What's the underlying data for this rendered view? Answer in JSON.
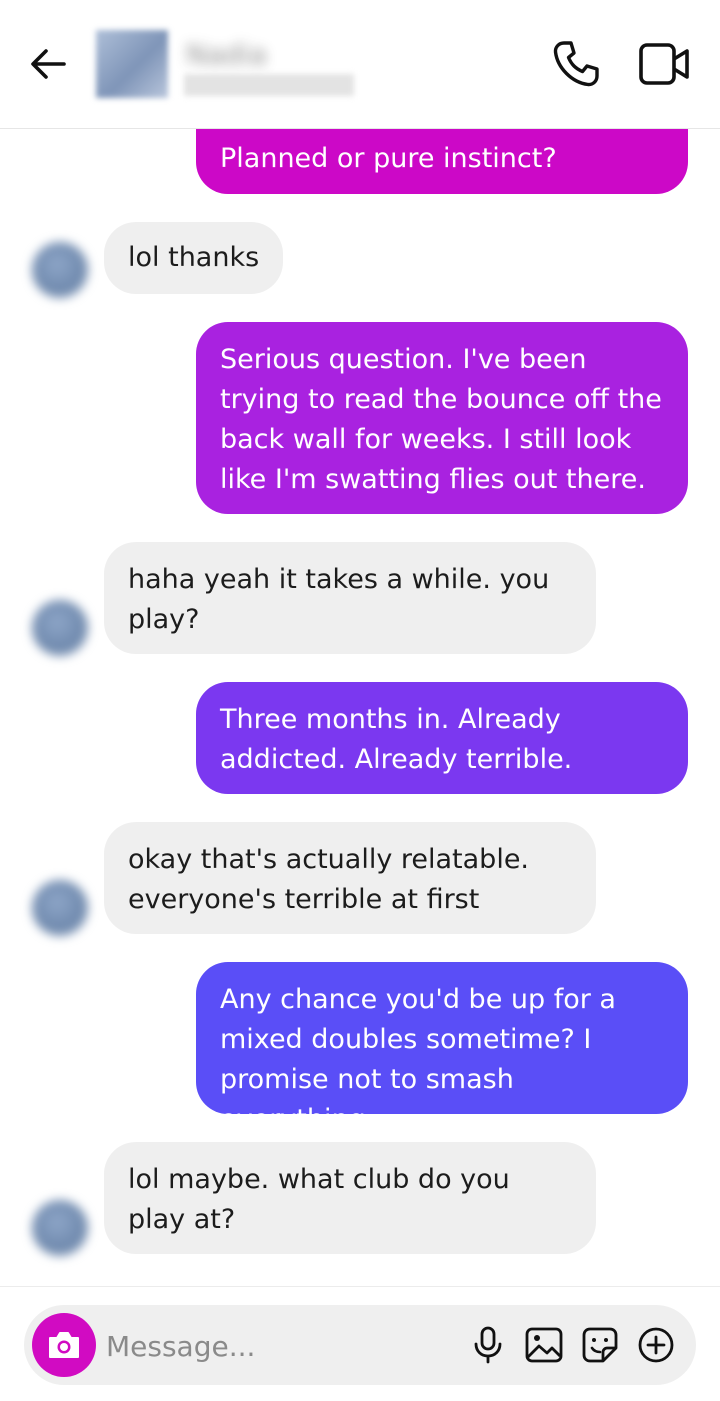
{
  "header": {
    "contact_name": "Nadia",
    "back_icon": "arrow-left-icon",
    "call_icon": "phone-icon",
    "video_icon": "video-camera-icon"
  },
  "messages": [
    {
      "sender": "me",
      "text": "Planned or pure instinct?",
      "color": "#cc08c7"
    },
    {
      "sender": "them",
      "text": "lol thanks"
    },
    {
      "sender": "me",
      "text": "Serious question. I've been trying to read the bounce off the back wall for weeks. I still look like I'm swatting flies out there.",
      "color": "#a922e0"
    },
    {
      "sender": "them",
      "text": "haha yeah it takes a while. you play?"
    },
    {
      "sender": "me",
      "text": "Three months in. Already addicted. Already terrible.",
      "color": "#7b38f0"
    },
    {
      "sender": "them",
      "text": "okay that's actually relatable. everyone's terrible at first"
    },
    {
      "sender": "me",
      "text": "Any chance you'd be up for a mixed doubles sometime? I promise not to smash everything.",
      "color": "#5a4ef7"
    },
    {
      "sender": "them",
      "text": "lol maybe. what club do you play at?"
    }
  ],
  "composer": {
    "placeholder": "Message...",
    "camera_icon": "camera-icon",
    "mic_icon": "microphone-icon",
    "gallery_icon": "image-icon",
    "sticker_icon": "sticker-icon",
    "plus_icon": "plus-circle-icon",
    "accent": "#d10bc2"
  }
}
